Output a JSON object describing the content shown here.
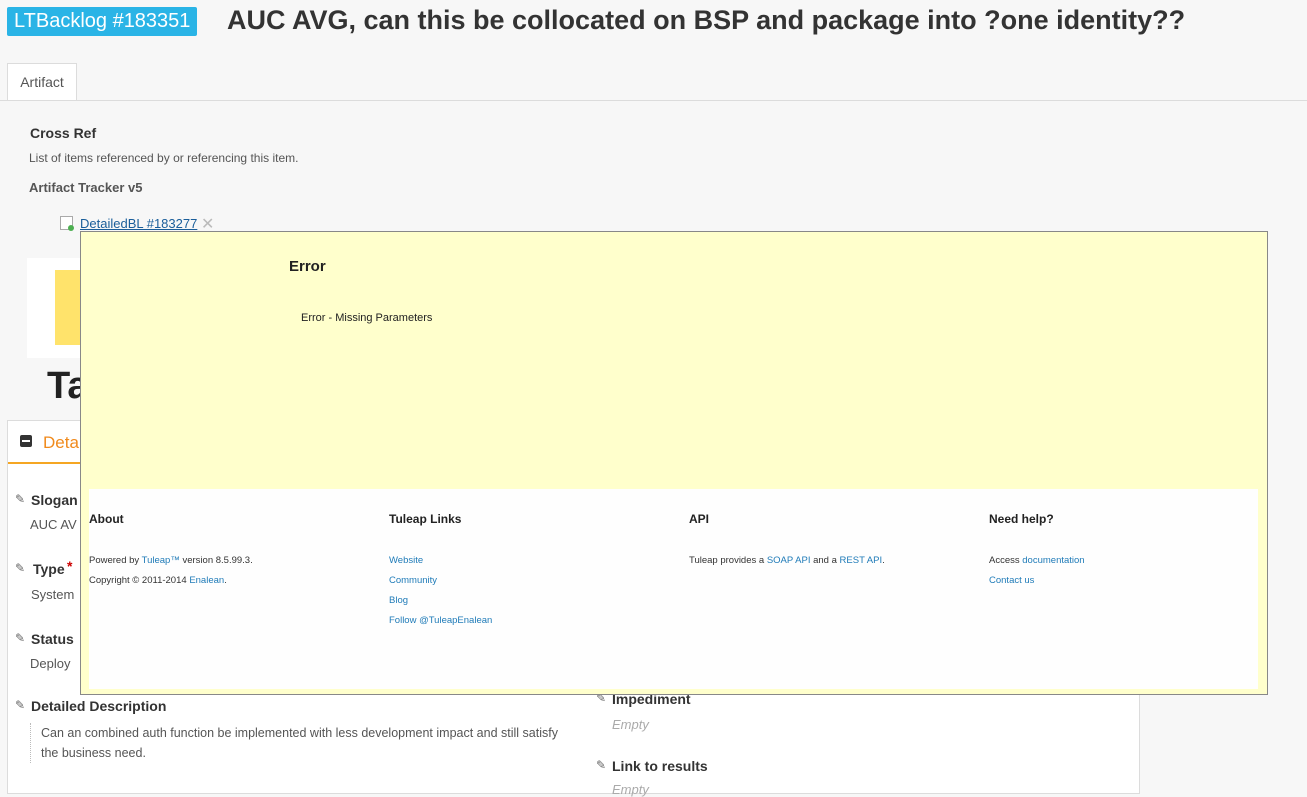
{
  "header": {
    "badge": "LTBacklog #183351",
    "title": "AUC AVG, can this be collocated on BSP and package into ?one identity??"
  },
  "tabs": [
    {
      "label": "Artifact"
    }
  ],
  "cross_ref": {
    "title": "Cross Ref",
    "description": "List of items referenced by or referencing this item.",
    "tracker": "Artifact Tracker v5",
    "link": "DetailedBL #183277",
    "remove": "✕"
  },
  "background": {
    "heading": "Ta",
    "details_label": "Detai",
    "fields": {
      "slogan_label": "Slogan",
      "slogan_value": "AUC AV",
      "type_label": "Type",
      "type_value": "System",
      "status_label": "Status",
      "status_value": "Deploy",
      "desc_label": "Detailed Description",
      "desc_value": "Can an combined auth function be implemented with less development impact and still satisfy the business need.",
      "impediment_label": "Impediment",
      "impediment_value": "Empty",
      "link_label": "Link to results",
      "link_value": "Empty"
    },
    "required_mark": "*",
    "pencil": "✎"
  },
  "dialog": {
    "title": "Error",
    "message": "Error - Missing Parameters"
  },
  "footer": {
    "about": {
      "title": "About",
      "powered_prefix": "Powered by ",
      "powered_link": "Tuleap™",
      "powered_suffix": " version 8.5.99.3.",
      "copyright_prefix": "Copyright © 2011-2014 ",
      "copyright_link": "Enalean",
      "copyright_suffix": "."
    },
    "links": {
      "title": "Tuleap Links",
      "items": [
        "Website",
        "Community",
        "Blog",
        "Follow @TuleapEnalean"
      ]
    },
    "api": {
      "title": "API",
      "prefix": "Tuleap provides a ",
      "soap": "SOAP API",
      "middle": " and a ",
      "rest": "REST API",
      "suffix": "."
    },
    "help": {
      "title": "Need help?",
      "access_prefix": "Access ",
      "doc_link": "documentation",
      "contact": "Contact us"
    }
  },
  "colors": {
    "badge": "#2ab4e6",
    "dialog_bg": "#ffffcc",
    "link": "#1f7bb8",
    "accent": "#f08a1c"
  }
}
